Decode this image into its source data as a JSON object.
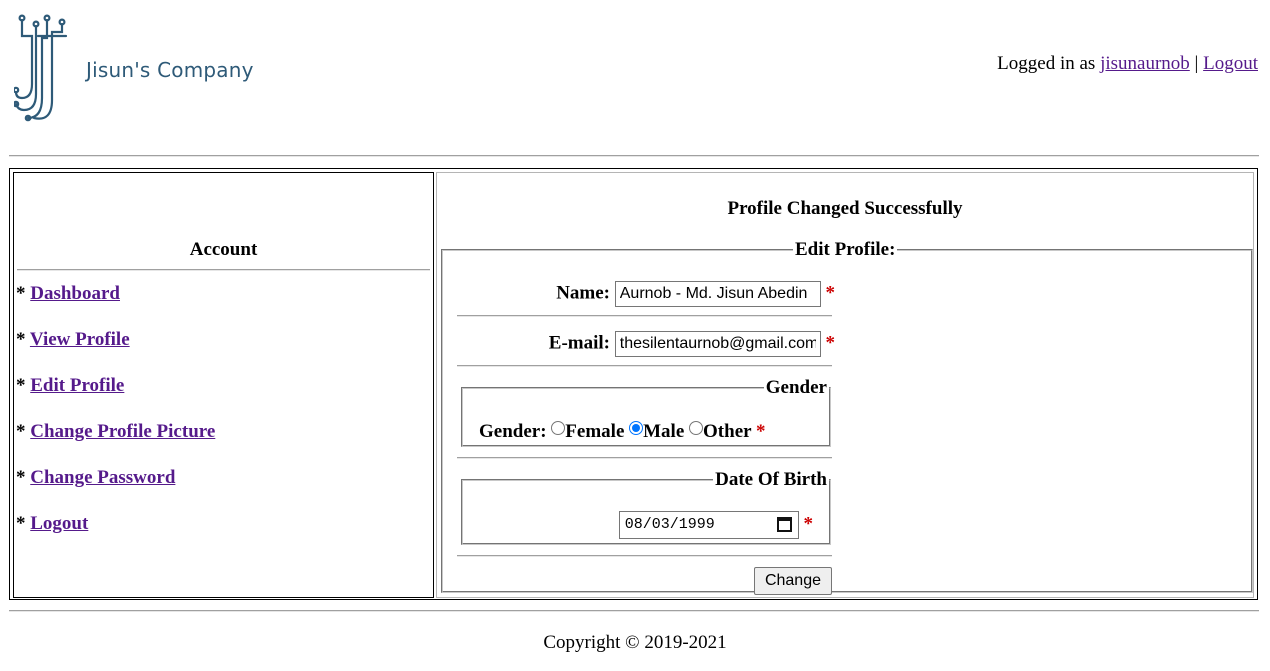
{
  "header": {
    "logo_text": "Jisun's Company",
    "logged_in_prefix": "Logged in as",
    "username": "jisunaurnob",
    "separator": "|",
    "logout_label": "Logout"
  },
  "sidebar": {
    "title": "Account",
    "bullet": "*",
    "items": [
      {
        "label": "Dashboard"
      },
      {
        "label": "View Profile"
      },
      {
        "label": "Edit Profile"
      },
      {
        "label": "Change Profile Picture"
      },
      {
        "label": "Change Password"
      },
      {
        "label": "Logout"
      }
    ]
  },
  "main": {
    "status_message": "Profile Changed Successfully",
    "form_legend": "Edit Profile:",
    "name_label": "Name:",
    "name_value": "Aurnob - Md. Jisun Abedin",
    "email_label": "E-mail:",
    "email_value": "thesilentaurnob@gmail.com",
    "required_mark": "*",
    "gender_legend": "Gender",
    "gender_label": "Gender:",
    "gender_options": [
      "Female",
      "Male",
      "Other"
    ],
    "gender_selected": "Male",
    "dob_legend": "Date Of Birth",
    "dob_value": "08/03/1999",
    "submit_label": "Change"
  },
  "footer": {
    "copyright": "Copyright © 2019-2021"
  },
  "colors": {
    "link": "#551a8b",
    "required": "#cc0000",
    "logo": "#2e5a78",
    "radio_accent": "#0075ff"
  },
  "icons": [
    "company-logo-icon",
    "calendar-icon"
  ]
}
